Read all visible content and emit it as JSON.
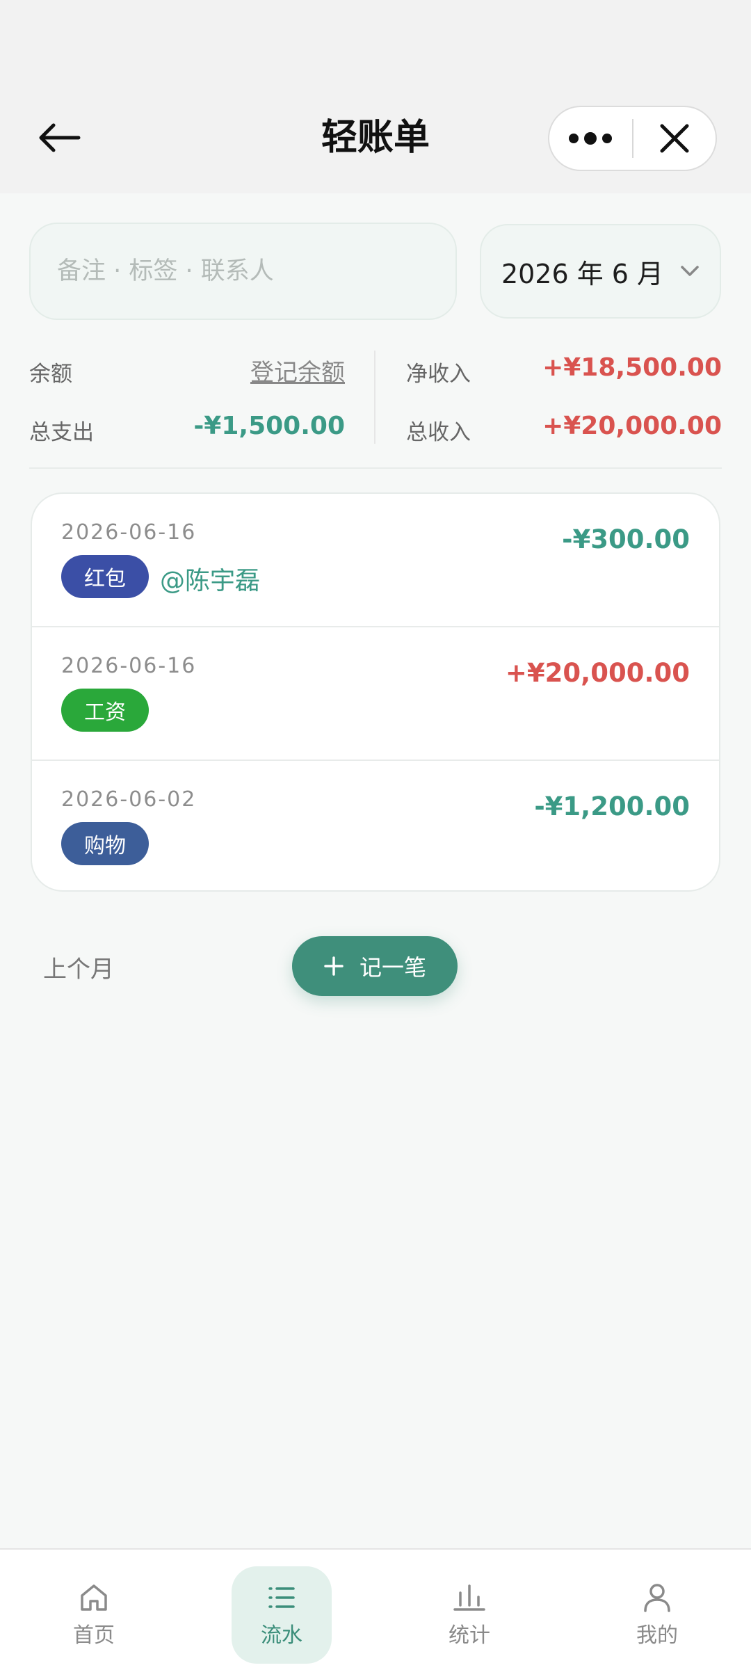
{
  "header": {
    "title": "轻账单",
    "back_icon": "arrow-left-icon",
    "more_icon": "more-dots-icon",
    "close_icon": "close-icon"
  },
  "filter": {
    "search_placeholder": "备注 · 标签 · 联系人",
    "month_label": "2026 年 6 月"
  },
  "summary": {
    "balance_label": "余额",
    "balance_action": "登记余额",
    "net_income_label": "净收入",
    "net_income_value": "+¥18,500.00",
    "total_expense_label": "总支出",
    "total_expense_value": "-¥1,500.00",
    "total_income_label": "总收入",
    "total_income_value": "+¥20,000.00"
  },
  "transactions": [
    {
      "date": "2026-06-16",
      "tag": "红包",
      "tag_color": "#3b4fa6",
      "contact": "@陈宇磊",
      "amount": "-¥300.00",
      "type": "expense"
    },
    {
      "date": "2026-06-16",
      "tag": "工资",
      "tag_color": "#2aa83a",
      "contact": "",
      "amount": "+¥20,000.00",
      "type": "income"
    },
    {
      "date": "2026-06-02",
      "tag": "购物",
      "tag_color": "#3d5e99",
      "contact": "",
      "amount": "-¥1,200.00",
      "type": "expense"
    }
  ],
  "actions": {
    "prev_month": "上个月",
    "add_record": "记一笔"
  },
  "tabs": [
    {
      "label": "首页",
      "icon": "home-icon",
      "active": false
    },
    {
      "label": "流水",
      "icon": "list-icon",
      "active": true
    },
    {
      "label": "统计",
      "icon": "bar-chart-icon",
      "active": false
    },
    {
      "label": "我的",
      "icon": "user-icon",
      "active": false
    }
  ],
  "colors": {
    "accent": "#3f8f7b",
    "income": "#d9534f",
    "expense": "#3b9a86"
  }
}
